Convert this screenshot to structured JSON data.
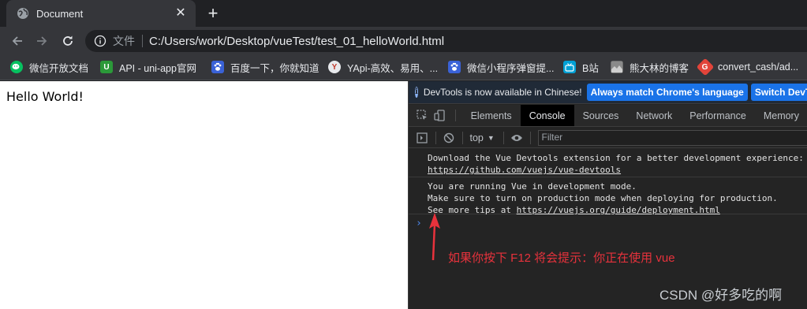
{
  "tab": {
    "title": "Document"
  },
  "address": {
    "chip": "文件",
    "url": "C:/Users/work/Desktop/vueTest/test_01_helloWorld.html"
  },
  "bookmarks": [
    {
      "label": "微信开放文档",
      "icon": "wechat-icon",
      "color": "#07c160"
    },
    {
      "label": "API - uni-app官网",
      "icon": "uniapp-icon",
      "color": "#2b9939",
      "glyph": "U"
    },
    {
      "label": "百度一下，你就知道",
      "icon": "baidu-paw-icon",
      "color": "#3a62d7"
    },
    {
      "label": "YApi-高效、易用、...",
      "icon": "yapi-icon",
      "color": "#e8eaed",
      "glyph": "Y"
    },
    {
      "label": "微信小程序弹窗提...",
      "icon": "baidu-paw-icon",
      "color": "#3a62d7"
    },
    {
      "label": "B站",
      "icon": "bilibili-icon",
      "color": "#00a1d6"
    },
    {
      "label": "熊大林的博客",
      "icon": "blog-avatar-icon",
      "color": "#8a8a8a"
    },
    {
      "label": "convert_cash/ad...",
      "icon": "git-icon",
      "color": "#e2443a",
      "glyph": "G"
    }
  ],
  "page": {
    "text": "Hello World!"
  },
  "devtools": {
    "infobar": {
      "text": "DevTools is now available in Chinese!",
      "match_button": "Always match Chrome's language",
      "switch_button": "Switch DevTo"
    },
    "tabs": [
      "Elements",
      "Console",
      "Sources",
      "Network",
      "Performance",
      "Memory"
    ],
    "active_tab": "Console",
    "console": {
      "context": "top",
      "filter_placeholder": "Filter",
      "messages": [
        {
          "line1": "Download the Vue Devtools extension for a better development experience:",
          "link": "https://github.com/vuejs/vue-devtools"
        },
        {
          "line1": "You are running Vue in development mode.",
          "line2": "Make sure to turn on production mode when deploying for production.",
          "line3_prefix": "See more tips at ",
          "link": "https://vuejs.org/guide/deployment.html"
        }
      ],
      "prompt": "›"
    }
  },
  "annotation": {
    "text": "如果你按下 F12 将会提示：你正在使用 vue",
    "color": "#e8323c"
  },
  "watermark": "CSDN @好多吃的啊"
}
